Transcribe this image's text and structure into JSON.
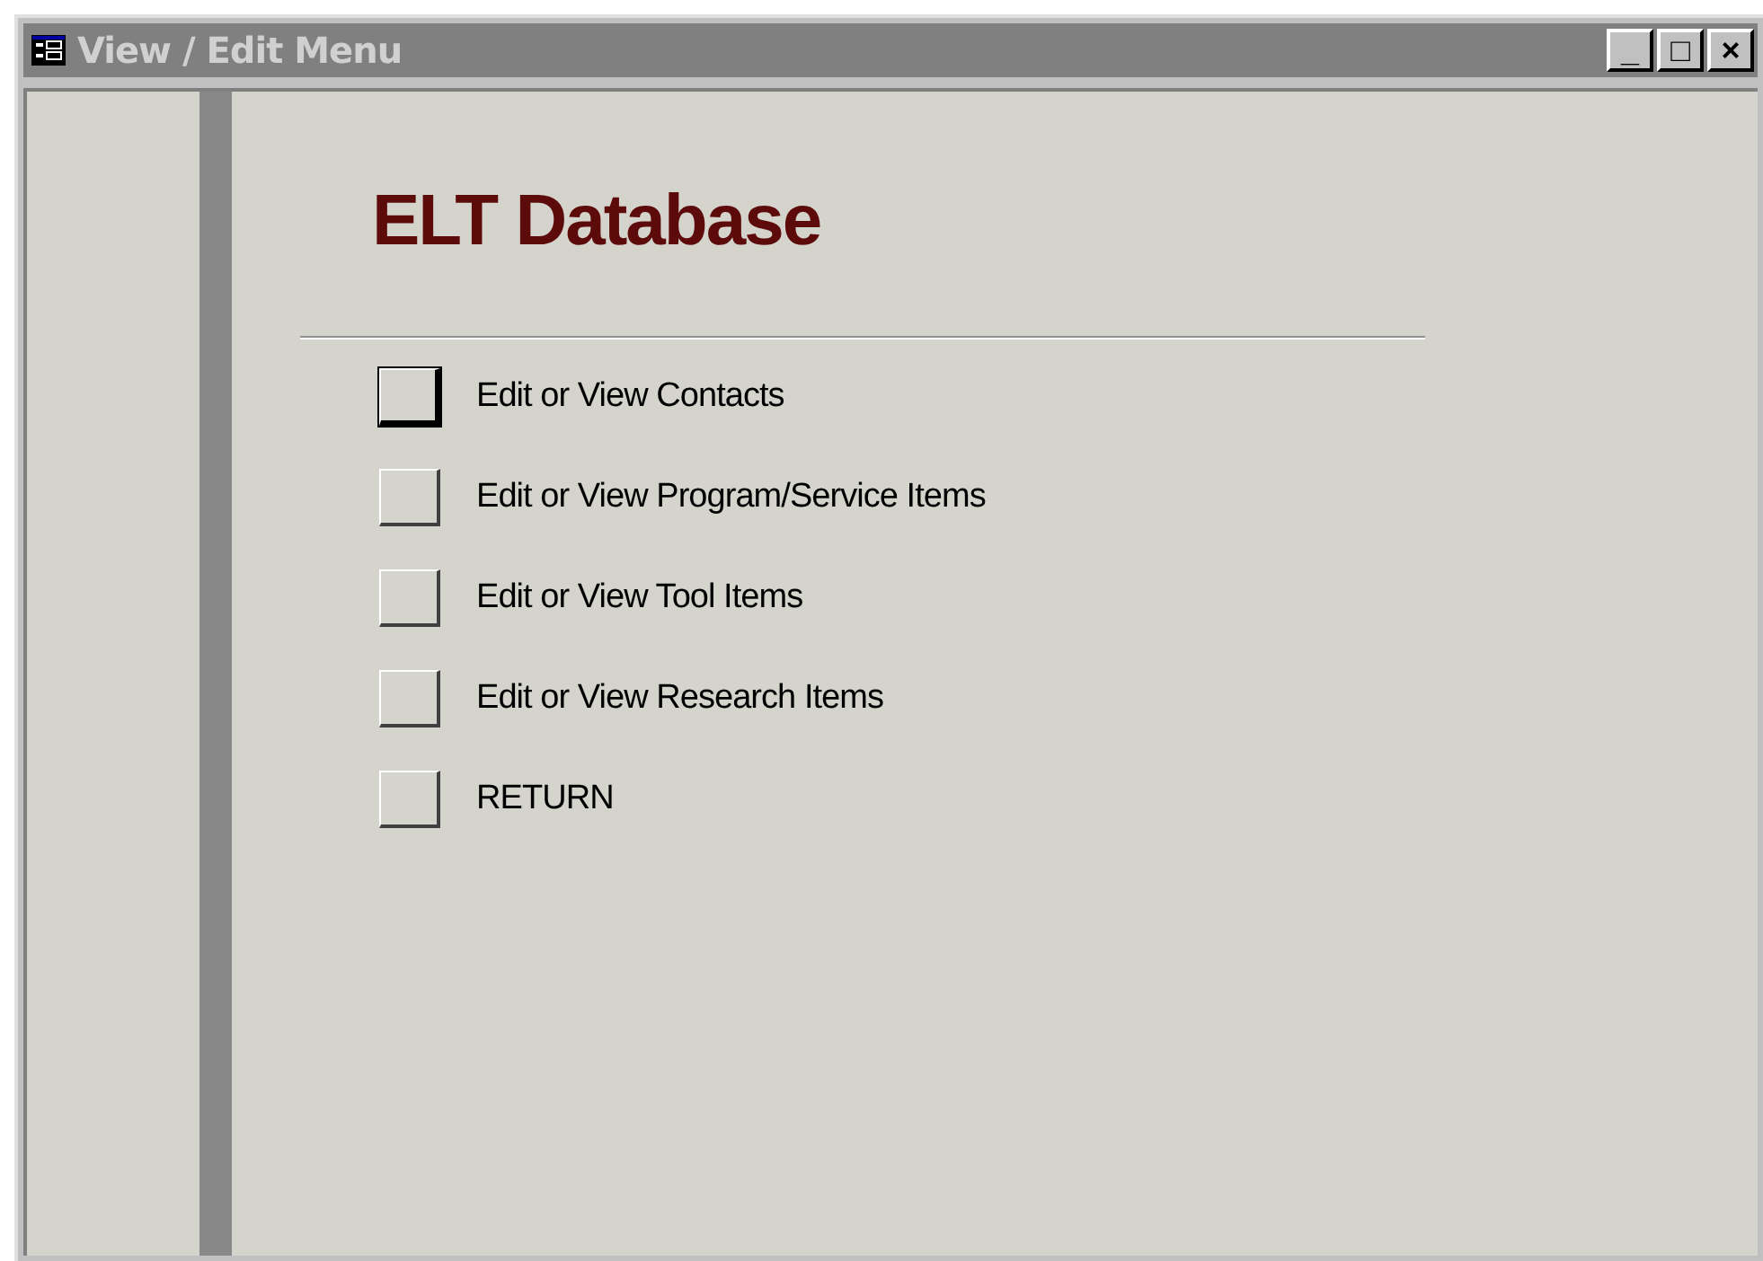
{
  "window": {
    "title": "View / Edit Menu",
    "controls": [
      "_",
      "□",
      "×"
    ]
  },
  "heading": "ELT Database",
  "menu_items": [
    {
      "label": "Edit or View Contacts",
      "focused": true
    },
    {
      "label": "Edit or View Program/Service Items",
      "focused": false
    },
    {
      "label": "Edit or View Tool Items",
      "focused": false
    },
    {
      "label": "Edit or View Research Items",
      "focused": false
    },
    {
      "label": "RETURN",
      "focused": false
    }
  ]
}
